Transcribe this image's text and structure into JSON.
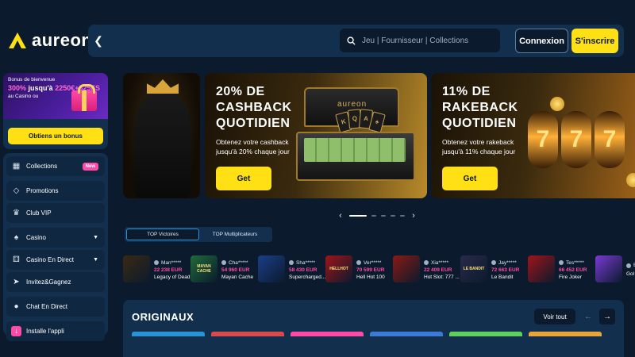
{
  "brand": {
    "name": "aureon",
    "accent": "#ffe014",
    "pink": "#ff4aa8"
  },
  "header": {
    "back_icon": "chevron-left-icon",
    "search_placeholder": "Jeu | Fournisseur | Collections",
    "login_label": "Connexion",
    "signup_label": "S'inscrire"
  },
  "bonus": {
    "line1": "Bonus de bienvenue",
    "amount_a": "300%",
    "amount_b": " jusqu'à ",
    "amount_c": "2250€+325FS",
    "line3": "au Casino ou",
    "button": "Obtiens un bonus"
  },
  "sidebar": {
    "items": [
      {
        "label": "Collections",
        "badge": "New",
        "icon": "collections-icon"
      },
      {
        "label": "Promotions",
        "icon": "tag-icon"
      },
      {
        "label": "Club VIP",
        "icon": "crown-icon"
      },
      {
        "label": "Casino",
        "icon": "spade-icon"
      },
      {
        "label": "Casino En Direct",
        "icon": "dice-icon"
      },
      {
        "label": "Invitez&Gagnez",
        "icon": "megaphone-icon"
      },
      {
        "label": "Chat En Direct",
        "icon": "chat-icon"
      },
      {
        "label": "Installe l'appli",
        "icon": "download-icon"
      }
    ]
  },
  "banners": [
    {
      "title": "20% DE CASHBACK QUOTIDIEN",
      "desc": "Obtenez votre cashback jusqu'à 20% chaque jour",
      "button": "Get",
      "case_logo": "aureon"
    },
    {
      "title": "11% DE RAKEBACK QUOTIDIEN",
      "desc": "Obtenez votre rakeback jusqu'à 11% chaque jour",
      "button": "Get",
      "reel_symbol": "7"
    }
  ],
  "carousel": {
    "prev": "‹",
    "next": "›",
    "active_index": 0,
    "count": 6
  },
  "tabs": [
    {
      "label": "TOP Victoires",
      "active": true
    },
    {
      "label": "TOP Multiplicateurs",
      "active": false
    }
  ],
  "wins": [
    {
      "user": "Man*****",
      "amount": "22 238 EUR",
      "game": "Legacy of Dead",
      "color": "#3a2a12"
    },
    {
      "user": "Cha*****",
      "amount": "54 960 EUR",
      "game": "Mayan Cache",
      "color": "#1f6b3a"
    },
    {
      "user": "Sha*****",
      "amount": "58 430 EUR",
      "game": "Supercharged...",
      "color": "#1a3e8a"
    },
    {
      "user": "Ver*****",
      "amount": "70 599 EUR",
      "game": "Hell Hot 100",
      "color": "#a0141a"
    },
    {
      "user": "Xia*****",
      "amount": "22 409 EUR",
      "game": "Hot Slot: 777 ...",
      "color": "#8a1a14"
    },
    {
      "user": "Jay*****",
      "amount": "72 663 EUR",
      "game": "Le Bandit",
      "color": "#2a2a4a"
    },
    {
      "user": "Tes*****",
      "amount": "66 452 EUR",
      "game": "Fire Joker",
      "color": "#a0141a"
    },
    {
      "user": "Bel*****",
      "amount": "",
      "game": "Gol",
      "color": "#7a3ad5"
    }
  ],
  "thumb_labels": [
    "",
    "MAYAN CACHE",
    "",
    "HELLHOT",
    "",
    "LE BANDIT",
    "",
    ""
  ],
  "originals": {
    "title": "ORIGINAUX",
    "see_all": "Voir tout",
    "strip_colors": [
      "#2a93d5",
      "#d94a4a",
      "#ff4aa8",
      "#3a7bd5",
      "#5fd05f",
      "#e8a53a"
    ]
  }
}
